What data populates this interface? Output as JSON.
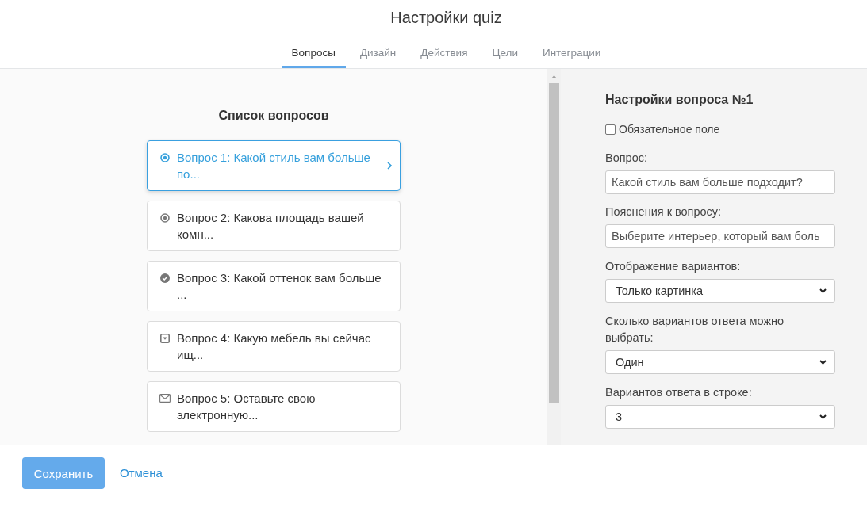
{
  "header": {
    "title": "Настройки quiz"
  },
  "tabs": [
    {
      "label": "Вопросы",
      "selected": true
    },
    {
      "label": "Дизайн",
      "selected": false
    },
    {
      "label": "Действия",
      "selected": false
    },
    {
      "label": "Цели",
      "selected": false
    },
    {
      "label": "Интеграции",
      "selected": false
    }
  ],
  "question_list": {
    "title": "Список вопросов",
    "questions": [
      {
        "kind": "radio",
        "label": "Вопрос 1: Какой стиль вам больше по...",
        "selected": true
      },
      {
        "kind": "radio",
        "label": "Вопрос 2: Какова площадь вашей комн...",
        "selected": false
      },
      {
        "kind": "check",
        "label": "Вопрос 3: Какой оттенок вам больше ...",
        "selected": false
      },
      {
        "kind": "dropdown",
        "label": "Вопрос 4: Какую мебель вы сейчас ищ...",
        "selected": false
      },
      {
        "kind": "email",
        "label": "Вопрос 5: Оставьте свою электронную...",
        "selected": false
      }
    ]
  },
  "question_settings": {
    "title": "Настройки вопроса №1",
    "required": {
      "label": "Обязательное поле",
      "checked": false
    },
    "fields": [
      {
        "kind": "input",
        "label": "Вопрос:",
        "value": "Какой стиль вам больше подходит?"
      },
      {
        "kind": "input",
        "label": "Пояснения к вопросу:",
        "value": "Выберите интерьер, который вам боль"
      },
      {
        "kind": "select",
        "label": "Отображение вариантов:",
        "value": "Только картинка"
      },
      {
        "kind": "select",
        "label": "Сколько вариантов ответа можно выбрать:",
        "value": "Один"
      },
      {
        "kind": "select",
        "label": "Вариантов ответа в строке:",
        "value": "3"
      }
    ]
  },
  "footer": {
    "buttons": [
      {
        "kind": "primary",
        "label": "Сохранить"
      },
      {
        "kind": "link",
        "label": "Отмена"
      }
    ]
  }
}
